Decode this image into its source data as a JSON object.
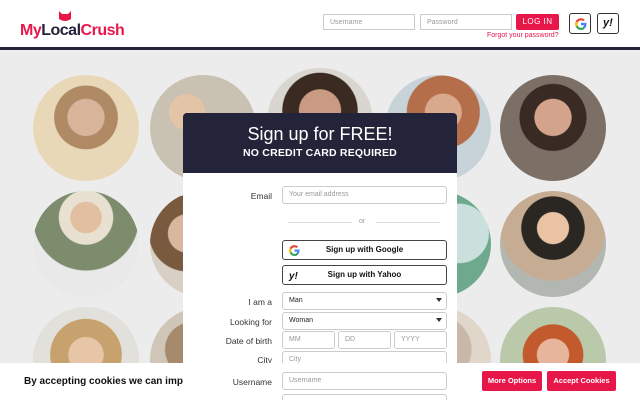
{
  "brand": {
    "my": "My",
    "local": "Local",
    "crush": "Crush"
  },
  "header": {
    "username_placeholder": "Username",
    "password_placeholder": "Password",
    "login_label": "LOG IN",
    "forgot_label": "Forgot your password?"
  },
  "modal": {
    "title": "Sign up for FREE!",
    "subtitle": "NO CREDIT CARD REQUIRED",
    "email_label": "Email",
    "email_placeholder": "Your email address",
    "or_label": "or",
    "google_label": "Sign up with Google",
    "yahoo_label": "Sign up with Yahoo",
    "iam_label": "I am a",
    "iam_value": "Man",
    "looking_label": "Looking for",
    "looking_value": "Woman",
    "dob_label": "Date of birth",
    "dob_mm": "MM",
    "dob_dd": "DD",
    "dob_yyyy": "YYYY",
    "city_label": "City",
    "city_placeholder": "City",
    "username_label": "Username",
    "username_placeholder": "Username"
  },
  "cookie": {
    "text": "By accepting cookies we can improv",
    "more_label": "More Options",
    "accept_label": "Accept Cookies"
  },
  "colors": {
    "accent": "#e8174a",
    "dark": "#23243a"
  }
}
